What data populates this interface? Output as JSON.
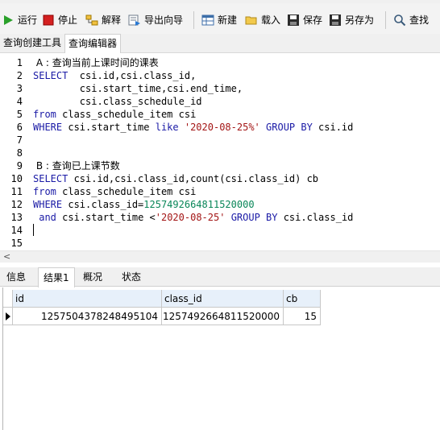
{
  "toolbar": {
    "run": "运行",
    "stop": "停止",
    "explain": "解释",
    "export_wizard": "导出向导",
    "new": "新建",
    "load": "载入",
    "save": "保存",
    "save_as": "另存为",
    "find": "查找"
  },
  "editor_tabs": [
    "查询创建工具",
    "查询编辑器"
  ],
  "code": {
    "lines": [
      {
        "n": "1",
        "tokens": [
          {
            "t": " A : 查询当前上课时间的课表",
            "c": "cm"
          }
        ]
      },
      {
        "n": "2",
        "tokens": [
          {
            "t": "SELECT",
            "c": "kw"
          },
          {
            "t": "  csi.id,csi.class_id,",
            "c": "id"
          }
        ]
      },
      {
        "n": "3",
        "tokens": [
          {
            "t": "        csi.start_time,csi.end_time,",
            "c": "id"
          }
        ]
      },
      {
        "n": "4",
        "tokens": [
          {
            "t": "        csi.class_schedule_id",
            "c": "id"
          }
        ]
      },
      {
        "n": "5",
        "tokens": [
          {
            "t": "from",
            "c": "kw"
          },
          {
            "t": " class_schedule_item csi",
            "c": "id"
          }
        ]
      },
      {
        "n": "6",
        "tokens": [
          {
            "t": "WHERE",
            "c": "kw"
          },
          {
            "t": " csi.start_time ",
            "c": "id"
          },
          {
            "t": "like",
            "c": "kw"
          },
          {
            "t": " ",
            "c": "id"
          },
          {
            "t": "'2020-08-25%'",
            "c": "str"
          },
          {
            "t": " ",
            "c": "id"
          },
          {
            "t": "GROUP BY",
            "c": "kw"
          },
          {
            "t": " csi.id",
            "c": "id"
          }
        ]
      },
      {
        "n": "7",
        "tokens": []
      },
      {
        "n": "8",
        "tokens": []
      },
      {
        "n": "9",
        "tokens": [
          {
            "t": " B : 查询已上课节数",
            "c": "cm"
          }
        ]
      },
      {
        "n": "10",
        "tokens": [
          {
            "t": "SELECT",
            "c": "kw"
          },
          {
            "t": " csi.id,csi.class_id,count(csi.class_id) cb",
            "c": "id"
          }
        ]
      },
      {
        "n": "11",
        "tokens": [
          {
            "t": "from",
            "c": "kw"
          },
          {
            "t": " class_schedule_item csi",
            "c": "id"
          }
        ]
      },
      {
        "n": "12",
        "tokens": [
          {
            "t": "WHERE",
            "c": "kw"
          },
          {
            "t": " csi.class_id=",
            "c": "id"
          },
          {
            "t": "1257492664811520000",
            "c": "num"
          }
        ]
      },
      {
        "n": "13",
        "tokens": [
          {
            "t": " ",
            "c": "id"
          },
          {
            "t": "and",
            "c": "kw"
          },
          {
            "t": " csi.start_time <",
            "c": "id"
          },
          {
            "t": "'2020-08-25'",
            "c": "str"
          },
          {
            "t": " ",
            "c": "id"
          },
          {
            "t": "GROUP BY",
            "c": "kw"
          },
          {
            "t": " csi.class_id",
            "c": "id"
          }
        ]
      },
      {
        "n": "14",
        "tokens": []
      },
      {
        "n": "15",
        "tokens": []
      }
    ]
  },
  "result_tabs": [
    "信息",
    "结果1",
    "概况",
    "状态"
  ],
  "result": {
    "columns": [
      "id",
      "class_id",
      "cb"
    ],
    "rows": [
      [
        "1257504378248495104",
        "1257492664811520000",
        "15"
      ]
    ]
  }
}
